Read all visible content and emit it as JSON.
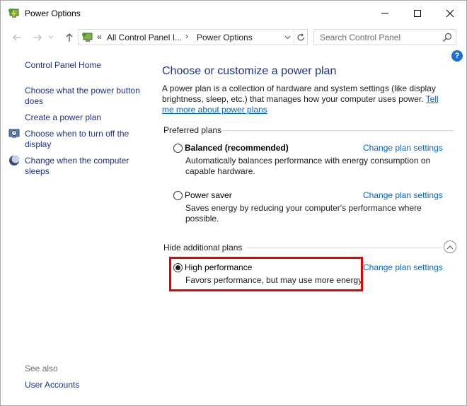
{
  "window": {
    "title": "Power Options",
    "controls": {
      "minimize": "—",
      "maximize": "☐",
      "close": "✕"
    }
  },
  "navigation": {
    "back_icon": "arrow-left-icon",
    "forward_icon": "arrow-right-icon",
    "up_icon": "arrow-up-icon",
    "breadcrumb": {
      "separator": "«",
      "items": [
        "All Control Panel I...",
        "Power Options"
      ],
      "arrow": "›"
    },
    "search_placeholder": "Search Control Panel"
  },
  "help_label": "?",
  "sidebar": {
    "home": "Control Panel Home",
    "links": [
      "Choose what the power button does",
      "Create a power plan",
      "Choose when to turn off the display",
      "Change when the computer sleeps"
    ],
    "see_also_label": "See also",
    "see_also_links": [
      "User Accounts"
    ]
  },
  "main": {
    "title": "Choose or customize a power plan",
    "intro_text": "A power plan is a collection of hardware and system settings (like display brightness, sleep, etc.) that manages how your computer uses power. ",
    "intro_link": "Tell me more about power plans",
    "preferred_header": "Preferred plans",
    "additional_header": "Hide additional plans",
    "plans": [
      {
        "name": "Balanced (recommended)",
        "description": "Automatically balances performance with energy consumption on capable hardware.",
        "link": "Change plan settings",
        "selected": false
      },
      {
        "name": "Power saver",
        "description": "Saves energy by reducing your computer's performance where possible.",
        "link": "Change plan settings",
        "selected": false
      },
      {
        "name": "High performance",
        "description": "Favors performance, but may use more energy.",
        "link": "Change plan settings",
        "selected": true
      }
    ]
  },
  "colors": {
    "link": "#0066cc",
    "nav_link": "#1e3287",
    "highlight": "#e60000"
  }
}
